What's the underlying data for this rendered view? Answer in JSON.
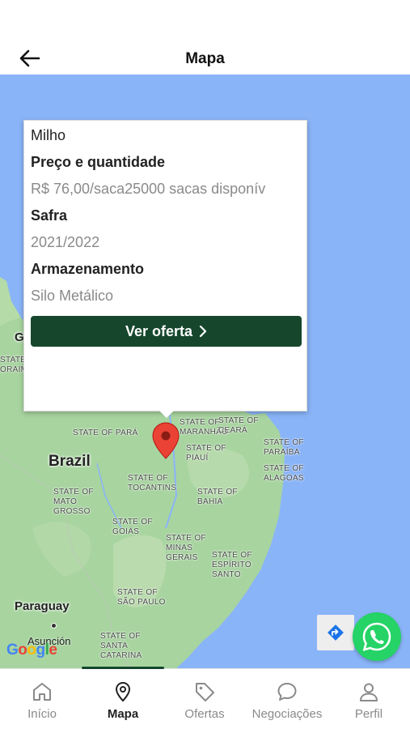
{
  "header": {
    "title": "Mapa",
    "back_icon": "arrow-left-icon"
  },
  "popup": {
    "product": "Milho",
    "price_heading": "Preço e quantidade",
    "price_value": "R$ 76,00/saca25000 sacas disponív",
    "harvest_heading": "Safra",
    "harvest_value": "2021/2022",
    "storage_heading": "Armazenamento",
    "storage_value": "Silo Metálico",
    "button_label": "Ver oferta",
    "button_icon": "chevron-right-icon"
  },
  "map": {
    "countries": [
      "Brazil",
      "Paraguay",
      "G"
    ],
    "cities": [
      "Asunción"
    ],
    "states": {
      "para": "STATE OF PARÁ",
      "maranhao": "STATE OF\nMARANHÃO",
      "ceara": "STATE OF\nCEARÁ",
      "piaui": "STATE OF\nPIAUÍ",
      "paraiba": "STATE OF\nPARAÍBA",
      "alagoas": "STATE OF\nALAGOAS",
      "tocantins": "STATE OF\nTOCANTINS",
      "mato_grosso": "STATE OF\nMATO\nGROSSO",
      "bahia": "STATE OF\nBAHIA",
      "goias": "STATE OF\nGOIÁS",
      "minas_gerais": "STATE OF\nMINAS\nGERAIS",
      "espirito_santo": "STATE OF\nESPÍRITO\nSANTO",
      "sao_paulo": "STATE OF\nSÃO PAULO",
      "santa_catarina": "STATE OF\nSANTA\nCATARINA",
      "partial": "STATE\nORAIM"
    },
    "attribution": "Google",
    "colors": {
      "water": "#8ab4f8",
      "land": "#a8d4a0"
    }
  },
  "actions": {
    "directions_icon": "directions-icon",
    "whatsapp_icon": "whatsapp-icon"
  },
  "tabs": [
    {
      "label": "Início",
      "icon": "home-icon"
    },
    {
      "label": "Mapa",
      "icon": "map-pin-icon"
    },
    {
      "label": "Ofertas",
      "icon": "tag-icon"
    },
    {
      "label": "Negociações",
      "icon": "chat-icon"
    },
    {
      "label": "Perfil",
      "icon": "user-icon"
    }
  ],
  "accent_color": "#16472d"
}
